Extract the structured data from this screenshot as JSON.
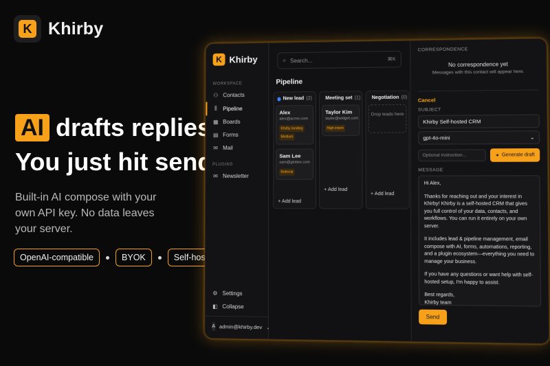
{
  "brand": {
    "name": "Khirby",
    "mark": "K"
  },
  "hero": {
    "badge": "AI",
    "line1_rest": "drafts replies.",
    "line2": "You just hit send.",
    "subcopy": "Built-in AI compose with your own API key. No data leaves your server.",
    "chips": [
      "OpenAI-compatible",
      "BYOK",
      "Self-hosted"
    ]
  },
  "colors": {
    "accent": "#f7a01a",
    "new_lead": "#3b82f6",
    "meeting_set": "#f7a01a",
    "negotiation": "#f7a01a"
  },
  "sidebar": {
    "title": "Khirby",
    "workspace_label": "WORKSPACE",
    "items": [
      {
        "label": "Contacts",
        "icon": "contacts-icon"
      },
      {
        "label": "Pipeline",
        "icon": "pipeline-icon"
      },
      {
        "label": "Boards",
        "icon": "boards-icon"
      },
      {
        "label": "Forms",
        "icon": "forms-icon"
      },
      {
        "label": "Mail",
        "icon": "mail-icon"
      }
    ],
    "plugins_label": "PLUGINS",
    "plugins": [
      {
        "label": "Newsletter",
        "icon": "newsletter-icon"
      }
    ],
    "settings": "Settings",
    "collapse": "Collapse",
    "user": {
      "initial": "A",
      "email": "admin@khirby.dev"
    }
  },
  "search": {
    "placeholder": "Search...",
    "shortcut": "⌘K"
  },
  "pipeline": {
    "title": "Pipeline",
    "columns": [
      {
        "name": "New lead",
        "count": "(2)"
      },
      {
        "name": "Meeting set",
        "count": "(1)"
      },
      {
        "name": "Negotiation",
        "count": "(0)"
      }
    ],
    "cards": {
      "alex": {
        "name": "Alex",
        "email": "alex@acme.com",
        "tags": [
          "Khirby landing",
          "Medium"
        ]
      },
      "sam": {
        "name": "Sam Lee",
        "email": "sam@globex.com",
        "tags": [
          "Referral"
        ]
      },
      "taylor": {
        "name": "Taylor Kim",
        "email": "taylor@widget.com",
        "tags": [
          "High intent"
        ]
      }
    },
    "drop_text": "Drop leads here",
    "add_lead": "+ Add lead"
  },
  "detail": {
    "correspondence_label": "CORRESPONDENCE",
    "no_corr": "No correspondence yet",
    "no_corr_sub": "Messages with this contact will appear here.",
    "cancel": "Cancel",
    "subject_label": "SUBJECT",
    "subject_value": "Khirby Self-hosted CRM",
    "model_value": "gpt-4o-mini",
    "instruction_placeholder": "Optional instruction...",
    "generate_label": "Generate draft",
    "message_label": "MESSAGE",
    "message": {
      "greeting": "Hi Alex,",
      "p1": "Thanks for reaching out and your interest in Khirby! Khirby is a self-hosted CRM that gives you full control of your data, contacts, and workflows. You can run it entirely on your own server.",
      "p2": "It includes lead & pipeline management, email compose with AI, forms, automations, reporting, and a plugin ecosystem—everything you need to manage your business.",
      "p3": "If you have any questions or want help with self-hosted setup, I'm happy to assist.",
      "signoff": "Best regards,",
      "signature": "Khirby team"
    },
    "send_label": "Send"
  }
}
